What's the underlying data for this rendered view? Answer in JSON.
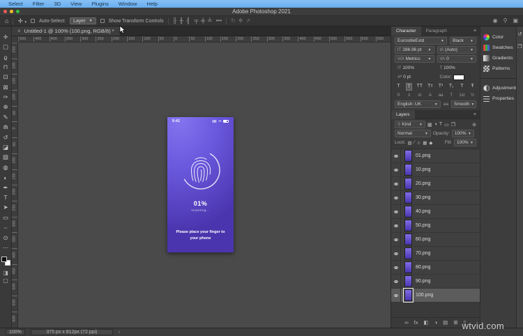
{
  "menu_bar": {
    "items": [
      "Select",
      "Filter",
      "3D",
      "View",
      "Plugins",
      "Window",
      "Help"
    ]
  },
  "title_bar": {
    "title": "Adobe Photoshop 2021"
  },
  "options_bar": {
    "auto_select_label": "Auto-Select:",
    "auto_select_value": "Layer",
    "show_transform_label": "Show Transform Controls",
    "align_icons": [
      "╟",
      "╫",
      "╢"
    ],
    "distribute_icons": [
      "╤",
      "╪",
      "╧"
    ],
    "more_label": "•••",
    "threed_icons": [
      "↻",
      "✥",
      "⇗"
    ],
    "right_icons": [
      {
        "name": "share-icon",
        "glyph": "◉"
      },
      {
        "name": "search-icon",
        "glyph": "⚲"
      },
      {
        "name": "workspace-icon",
        "glyph": "▣"
      }
    ]
  },
  "document_tab": {
    "close": "×",
    "title": "Untitled-1 @ 100% (100.png, RGB/8) *"
  },
  "rulers": {
    "horizontal": [
      "500",
      "450",
      "400",
      "350",
      "300",
      "250",
      "200",
      "150",
      "100",
      "50",
      "0",
      "50",
      "100",
      "150",
      "200",
      "250",
      "300",
      "350",
      "400",
      "450",
      "500",
      "550",
      "600",
      "650"
    ],
    "vertical": [
      "250",
      "200",
      "150",
      "100",
      "50",
      "0",
      "50",
      "100",
      "150",
      "200",
      "250",
      "300",
      "350",
      "400",
      "450",
      "500",
      "550",
      "600"
    ]
  },
  "tools": [
    {
      "name": "move-tool-icon",
      "glyph": "✛"
    },
    {
      "name": "marquee-tool-icon",
      "glyph": "▢"
    },
    {
      "name": "lasso-tool-icon",
      "glyph": "ϱ"
    },
    {
      "name": "object-selection-tool-icon",
      "glyph": "⊓"
    },
    {
      "name": "crop-tool-icon",
      "glyph": "⊡"
    },
    {
      "name": "frame-tool-icon",
      "glyph": "⊠"
    },
    {
      "name": "eyedropper-tool-icon",
      "glyph": "✑"
    },
    {
      "name": "healing-brush-tool-icon",
      "glyph": "⊕"
    },
    {
      "name": "brush-tool-icon",
      "glyph": "✎"
    },
    {
      "name": "clone-stamp-tool-icon",
      "glyph": "⋒"
    },
    {
      "name": "history-brush-tool-icon",
      "glyph": "↺"
    },
    {
      "name": "eraser-tool-icon",
      "glyph": "◪"
    },
    {
      "name": "gradient-tool-icon",
      "glyph": "▧"
    },
    {
      "name": "blur-tool-icon",
      "glyph": "◍"
    },
    {
      "name": "dodge-tool-icon",
      "glyph": "◐"
    },
    {
      "name": "pen-tool-icon",
      "glyph": "✒"
    },
    {
      "name": "type-tool-icon",
      "glyph": "T"
    },
    {
      "name": "path-selection-tool-icon",
      "glyph": "➤"
    },
    {
      "name": "rectangle-tool-icon",
      "glyph": "▭"
    },
    {
      "name": "hand-tool-icon",
      "glyph": "⌣"
    },
    {
      "name": "zoom-tool-icon",
      "glyph": "⊙"
    },
    {
      "name": "edit-toolbar-icon",
      "glyph": "⋯"
    }
  ],
  "toolbar_colors": {
    "foreground": "#0a0a0a",
    "background": "#ffffff"
  },
  "canvas": {
    "phone": {
      "time": "9:41",
      "progress": "01%",
      "scanning": "scanning...",
      "instruction1": "Please place your finger to",
      "instruction2": "your phone",
      "bg_top": "#8575f0",
      "bg_bottom": "#4b35ae"
    }
  },
  "character_panel": {
    "tab_character": "Character",
    "tab_paragraph": "Paragraph",
    "font_family": "EurostileExtd",
    "font_style": "Black",
    "size_label": "tT",
    "size": "286.96 pt",
    "leading_label": "tA",
    "leading": "(Auto)",
    "kerning_label": "V/A",
    "kerning": "Metrics",
    "tracking_label": "VA",
    "tracking": "0",
    "hscale_label": "IT",
    "hscale": "100%",
    "vscale_label": "T",
    "vscale": "100%",
    "baseline_label": "Aª",
    "baseline": "0 pt",
    "color_label": "Color:",
    "format_buttons": [
      "T",
      "T",
      "TT",
      "Tᴛ",
      "T¹",
      "T₁",
      "T",
      "Ŧ"
    ],
    "opentype_buttons": [
      "fi",
      "ś",
      "st",
      "A",
      "aa",
      "T",
      "1st",
      "½"
    ],
    "language": "English: UK",
    "antialias_label": "aa",
    "antialias": "Smooth"
  },
  "layers_panel": {
    "title": "Layers",
    "filter_kind": "Kind",
    "filter_icons": [
      "▦",
      "◑",
      "T",
      "▭",
      "❒"
    ],
    "pin_icon": "⊚",
    "blend_mode": "Normal",
    "opacity_label": "Opacity:",
    "opacity": "100%",
    "lock_label": "Lock:",
    "lock_icons": [
      "▨",
      "∕",
      "⊹",
      "▦",
      "◆"
    ],
    "fill_label": "Fill:",
    "fill": "100%",
    "layers": [
      {
        "name": "01.png"
      },
      {
        "name": "10.png"
      },
      {
        "name": "20.png"
      },
      {
        "name": "30.png"
      },
      {
        "name": "40.png"
      },
      {
        "name": "50.png"
      },
      {
        "name": "60.png"
      },
      {
        "name": "70.png"
      },
      {
        "name": "80.png"
      },
      {
        "name": "90.png"
      },
      {
        "name": "100.png",
        "selected": true
      }
    ],
    "bottom_icons": [
      {
        "name": "link-layers-icon",
        "glyph": "∞"
      },
      {
        "name": "layer-effects-icon",
        "glyph": "fx"
      },
      {
        "name": "layer-mask-icon",
        "glyph": "◧"
      },
      {
        "name": "adjustment-layer-icon",
        "glyph": "◑"
      },
      {
        "name": "group-layers-icon",
        "glyph": "▤"
      },
      {
        "name": "new-layer-icon",
        "glyph": "⊞"
      },
      {
        "name": "delete-layer-icon",
        "glyph": "▯"
      }
    ]
  },
  "dock": {
    "group1": [
      {
        "label": "Color",
        "icon_name": "color-icon"
      },
      {
        "label": "Swatches",
        "icon_name": "swatches-icon"
      },
      {
        "label": "Gradients",
        "icon_name": "gradients-icon"
      },
      {
        "label": "Patterns",
        "icon_name": "patterns-icon"
      }
    ],
    "group2": [
      {
        "label": "Adjustments",
        "icon_name": "adjustments-icon"
      },
      {
        "label": "Properties",
        "icon_name": "properties-icon"
      }
    ]
  },
  "collapsed_dock": [
    {
      "name": "history-panel-icon",
      "glyph": "↺"
    },
    {
      "name": "libraries-panel-icon",
      "glyph": "❒"
    }
  ],
  "status_bar": {
    "zoom": "100%",
    "doc_info": "375 px x 812px (72 ppi)",
    "chevron": "›"
  },
  "watermark": "wtvid.com"
}
